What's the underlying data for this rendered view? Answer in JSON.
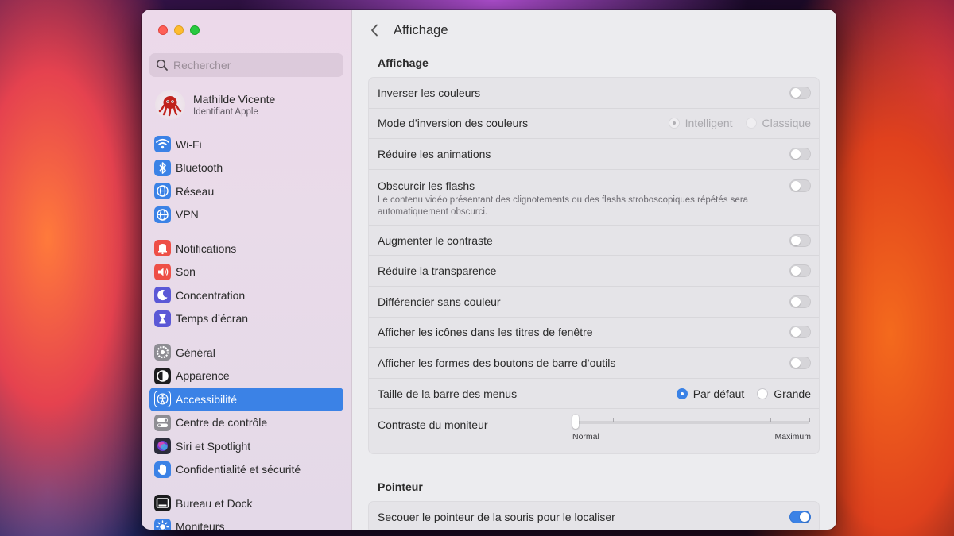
{
  "sidebar": {
    "search_placeholder": "Rechercher",
    "profile": {
      "name": "Mathilde Vicente",
      "subtitle": "Identifiant Apple"
    },
    "groups": [
      [
        {
          "label": "Wi-Fi",
          "icon": "wifi-icon",
          "color": "#3b82e6"
        },
        {
          "label": "Bluetooth",
          "icon": "bluetooth-icon",
          "color": "#3b82e6"
        },
        {
          "label": "Réseau",
          "icon": "globe-icon",
          "color": "#3b82e6"
        },
        {
          "label": "VPN",
          "icon": "globe-icon",
          "color": "#3b82e6"
        }
      ],
      [
        {
          "label": "Notifications",
          "icon": "bell-icon",
          "color": "#ee4f47"
        },
        {
          "label": "Son",
          "icon": "speaker-icon",
          "color": "#ee4f47"
        },
        {
          "label": "Concentration",
          "icon": "moon-icon",
          "color": "#5b58d6"
        },
        {
          "label": "Temps d’écran",
          "icon": "hourglass-icon",
          "color": "#5b58d6"
        }
      ],
      [
        {
          "label": "Général",
          "icon": "gear-icon",
          "color": "#8e8d93"
        },
        {
          "label": "Apparence",
          "icon": "appearance-icon",
          "color": "#1c1c1e"
        },
        {
          "label": "Accessibilité",
          "icon": "accessibility-icon",
          "color": "#3b82e6",
          "active": true
        },
        {
          "label": "Centre de contrôle",
          "icon": "toggles-icon",
          "color": "#8e8d93"
        },
        {
          "label": "Siri et Spotlight",
          "icon": "siri-icon",
          "color": "#2b2b3a"
        },
        {
          "label": "Confidentialité et sécurité",
          "icon": "hand-icon",
          "color": "#3b82e6"
        }
      ],
      [
        {
          "label": "Bureau et Dock",
          "icon": "dock-icon",
          "color": "#1c1c1e"
        },
        {
          "label": "Moniteurs",
          "icon": "sun-icon",
          "color": "#3b82e6"
        }
      ]
    ]
  },
  "content": {
    "title": "Affichage",
    "sections": [
      {
        "title": "Affichage",
        "rows": [
          {
            "label": "Inverser les couleurs",
            "control": "toggle",
            "on": false
          },
          {
            "label": "Mode d’inversion des couleurs",
            "control": "radio",
            "disabled": true,
            "options": [
              {
                "label": "Intelligent",
                "selected": true
              },
              {
                "label": "Classique",
                "selected": false
              }
            ]
          },
          {
            "label": "Réduire les animations",
            "control": "toggle",
            "on": false
          },
          {
            "label": "Obscurcir les flashs",
            "control": "toggle",
            "on": false,
            "subtitle": "Le contenu vidéo présentant des clignotements ou des flashs stroboscopiques répétés sera automatiquement obscurci."
          },
          {
            "label": "Augmenter le contraste",
            "control": "toggle",
            "on": false
          },
          {
            "label": "Réduire la transparence",
            "control": "toggle",
            "on": false
          },
          {
            "label": "Différencier sans couleur",
            "control": "toggle",
            "on": false
          },
          {
            "label": "Afficher les icônes dans les titres de fenêtre",
            "control": "toggle",
            "on": false
          },
          {
            "label": "Afficher les formes des boutons de barre d’outils",
            "control": "toggle",
            "on": false
          },
          {
            "label": "Taille de la barre des menus",
            "control": "radio",
            "disabled": false,
            "options": [
              {
                "label": "Par défaut",
                "selected": true
              },
              {
                "label": "Grande",
                "selected": false
              }
            ]
          },
          {
            "label": "Contraste du moniteur",
            "control": "slider",
            "value": 0,
            "ticks": 7,
            "min_label": "Normal",
            "max_label": "Maximum"
          }
        ]
      },
      {
        "title": "Pointeur",
        "rows": [
          {
            "label": "Secouer le pointeur de la souris pour le localiser",
            "control": "toggle",
            "on": true
          }
        ]
      }
    ]
  },
  "colors": {
    "accent": "#3b82e6",
    "close": "#fe5f57",
    "minimize": "#febc2e",
    "maximize": "#28c840"
  }
}
